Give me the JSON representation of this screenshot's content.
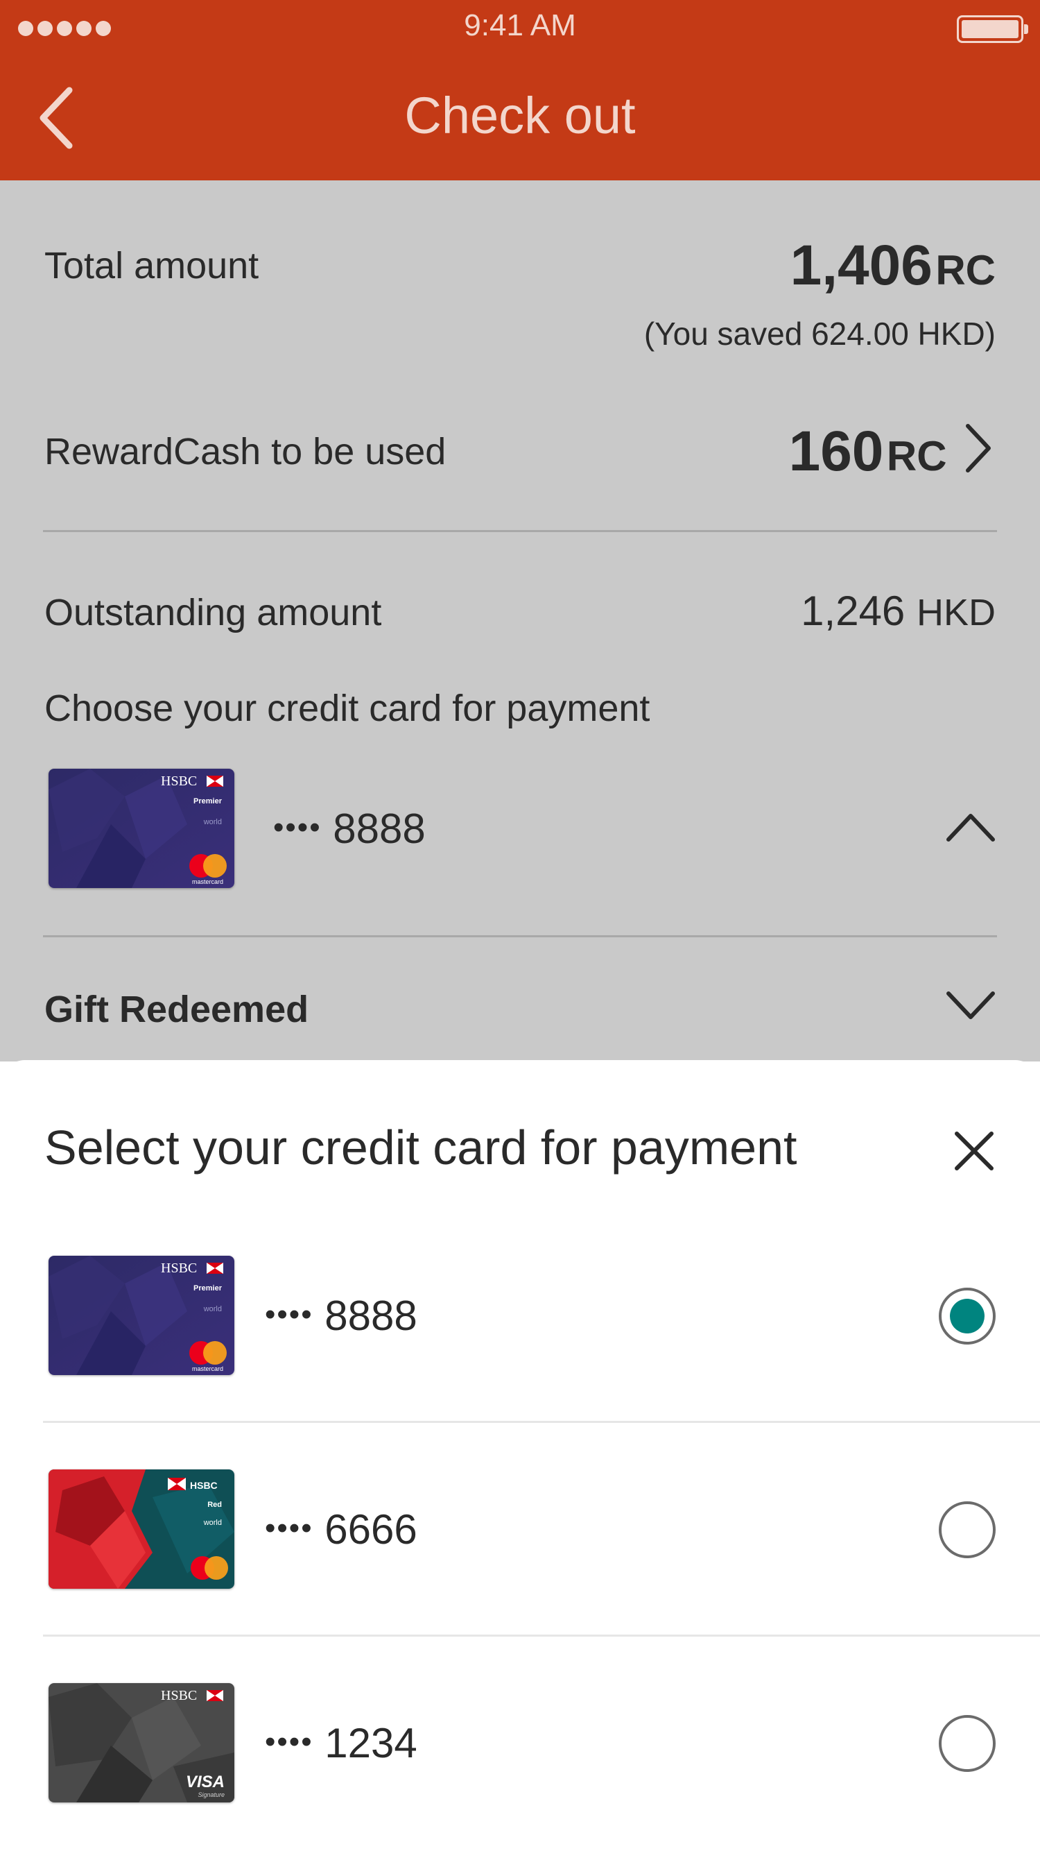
{
  "status_bar": {
    "time": "9:41 AM"
  },
  "header": {
    "title": "Check out"
  },
  "summary": {
    "total_label": "Total amount",
    "total_value": "1,406",
    "total_unit": "RC",
    "saved_note": "(You saved 624.00 HKD)",
    "rewardcash_label": "RewardCash to be used",
    "rewardcash_value": "160",
    "rewardcash_unit": "RC",
    "outstanding_label": "Outstanding amount",
    "outstanding_value": "1,246",
    "outstanding_unit": "HKD",
    "choose_card_label": "Choose your credit card for  payment",
    "selected_card_dots": "••••",
    "selected_card_last4": "8888",
    "gift_label": "Gift Redeemed"
  },
  "sheet": {
    "title": "Select your credit card for payment",
    "cards": [
      {
        "dots": "••••",
        "last4": "8888",
        "selected": true
      },
      {
        "dots": "••••",
        "last4": "6666",
        "selected": false
      },
      {
        "dots": "••••",
        "last4": "1234",
        "selected": false
      }
    ]
  },
  "card_art": {
    "brand": "HSBC",
    "premier_tier": "Premier",
    "premier_sub": "world",
    "premier_network": "mastercard",
    "red_tier": "Red",
    "red_sub": "world",
    "visa_network": "VISA",
    "visa_sub": "Signature"
  },
  "colors": {
    "header": "#c43a16",
    "overlay": "#c9c9c9",
    "radio_selected": "#00847f"
  }
}
